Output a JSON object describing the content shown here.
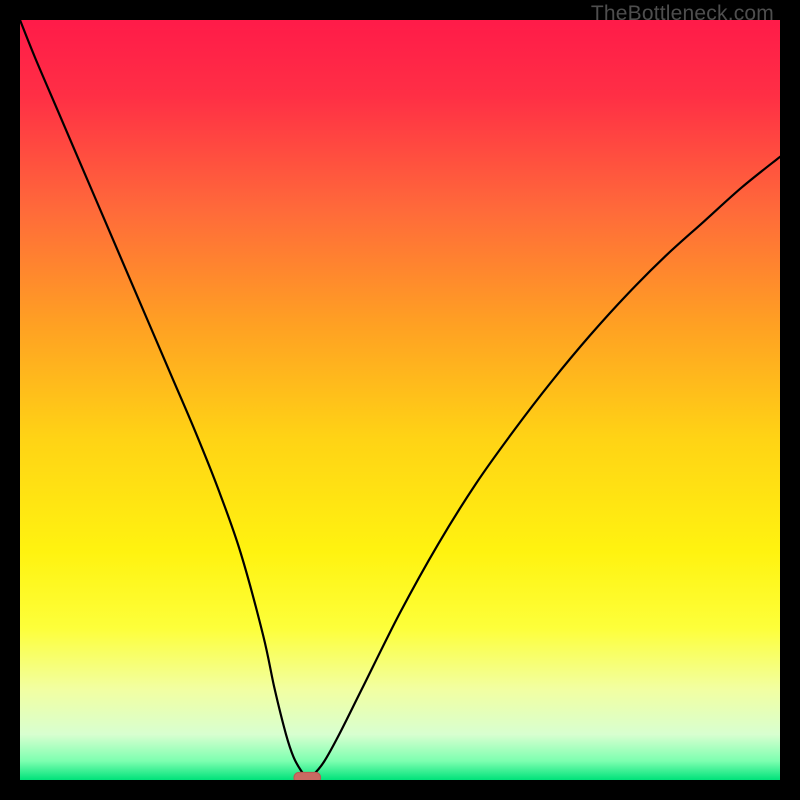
{
  "watermark": "TheBottleneck.com",
  "colors": {
    "gradient_stops": [
      {
        "offset": 0.0,
        "color": "#ff1b49"
      },
      {
        "offset": 0.1,
        "color": "#ff2f45"
      },
      {
        "offset": 0.25,
        "color": "#ff6a3a"
      },
      {
        "offset": 0.4,
        "color": "#ffa023"
      },
      {
        "offset": 0.55,
        "color": "#ffd315"
      },
      {
        "offset": 0.7,
        "color": "#fff310"
      },
      {
        "offset": 0.8,
        "color": "#fdff3a"
      },
      {
        "offset": 0.88,
        "color": "#f2ffa1"
      },
      {
        "offset": 0.94,
        "color": "#d8ffd0"
      },
      {
        "offset": 0.975,
        "color": "#7dffb0"
      },
      {
        "offset": 1.0,
        "color": "#00e27a"
      }
    ],
    "curve": "#000000",
    "marker_fill": "#c96a62",
    "marker_stroke": "#b85a53",
    "frame": "#000000"
  },
  "chart_data": {
    "type": "line",
    "title": "",
    "xlabel": "",
    "ylabel": "",
    "xlim": [
      0,
      100
    ],
    "ylim": [
      0,
      100
    ],
    "grid": false,
    "legend": false,
    "series": [
      {
        "name": "bottleneck-curve",
        "x": [
          0,
          2,
          5,
          8,
          11,
          14,
          17,
          20,
          23,
          26,
          29,
          32,
          33.5,
          35,
          36,
          37,
          37.8,
          38.5,
          40,
          42,
          45,
          50,
          55,
          60,
          65,
          70,
          75,
          80,
          85,
          90,
          95,
          100
        ],
        "y": [
          100,
          95,
          88,
          81,
          74,
          67,
          60,
          53,
          46,
          38.5,
          30,
          19,
          12,
          6,
          3,
          1.2,
          0.3,
          0.6,
          2.4,
          6,
          12,
          22,
          31,
          39,
          46,
          52.5,
          58.5,
          64,
          69,
          73.5,
          78,
          82
        ]
      }
    ],
    "annotations": [
      {
        "name": "min-marker",
        "shape": "rounded-rect",
        "x_center": 37.8,
        "y_center": 0.3,
        "width_pct": 3.5,
        "height_pct": 1.4
      }
    ]
  }
}
